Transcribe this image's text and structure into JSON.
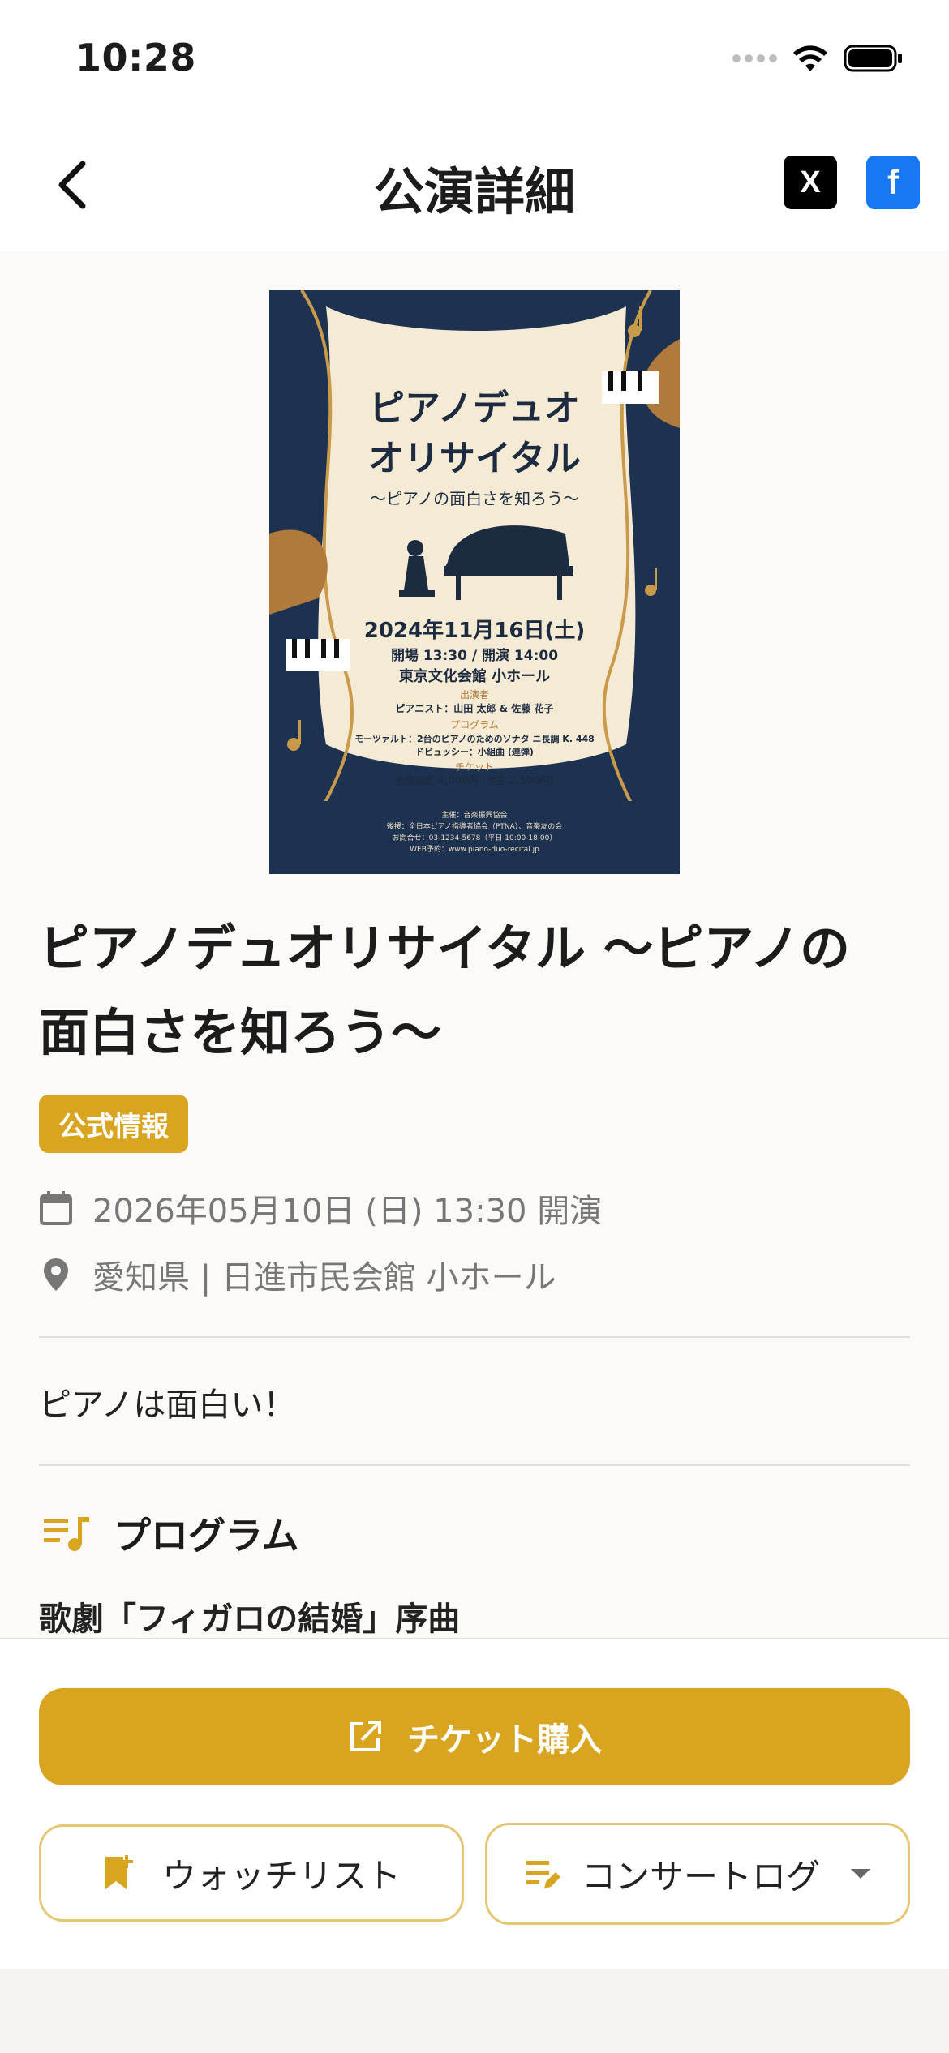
{
  "status_bar": {
    "time": "10:28"
  },
  "nav": {
    "title": "公演詳細",
    "share_x_label": "X",
    "share_fb_label": "f"
  },
  "poster": {
    "title_line1": "ピアノデュオ",
    "title_line2": "オリサイタル",
    "subtitle": "〜ピアノの面白さを知ろう〜",
    "date": "2024年11月16日(土)",
    "times": "開場 13:30 / 開演 14:00",
    "hall": "東京文化会館 小ホール",
    "performers_label": "出演者",
    "performers": "ピアニスト：山田 太郎 & 佐藤 花子",
    "program_label": "プログラム",
    "program_1": "モーツァルト：2台のピアノのためのソナタ ニ長調 K. 448",
    "program_2": "ドビュッシー：小組曲 (連弾)",
    "ticket_label": "チケット",
    "ticket_price": "全席指定 4,000円 (学生 2,500円)",
    "footer_1": "主催：音楽振興協会",
    "footer_2": "後援：全日本ピアノ指導者協会（PTNA）、音楽友の会",
    "footer_3": "お問合せ：03-1234-5678（平日 10:00-18:00）",
    "footer_4": "WEB予約：www.piano-duo-recital.jp"
  },
  "event": {
    "title_line1": "ピアノデュオリサイタル 〜ピアノの",
    "title_line2": "面白さを知ろう〜",
    "badge": "公式情報",
    "datetime": "2026年05月10日 (日) 13:30 開演",
    "venue": "愛知県 | 日進市民会館 小ホール",
    "description": "ピアノは面白い！"
  },
  "program": {
    "heading": "プログラム",
    "items": [
      "歌劇「フィガロの結婚」序曲"
    ]
  },
  "actions": {
    "ticket": "チケット購入",
    "watchlist": "ウォッチリスト",
    "concert_log": "コンサートログ"
  },
  "colors": {
    "accent": "#d9a520",
    "facebook": "#1877f2",
    "poster_navy": "#1d3150",
    "poster_cream": "#f5ead3"
  },
  "icons": {
    "back": "chevron-left-icon",
    "date": "calendar-icon",
    "venue": "location-pin-icon",
    "program": "playlist-icon",
    "ticket": "external-link-icon",
    "watchlist": "bookmark-add-icon",
    "log": "edit-list-icon",
    "dropdown": "caret-down-icon"
  }
}
